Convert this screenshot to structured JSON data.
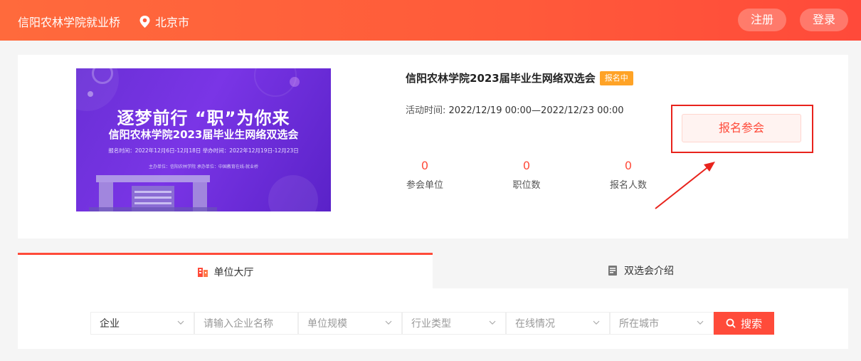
{
  "header": {
    "site_title": "信阳农林学院就业桥",
    "city": "北京市",
    "register_label": "注册",
    "login_label": "登录"
  },
  "event": {
    "title": "信阳农林学院2023届毕业生网络双选会",
    "status_badge": "报名中",
    "time_label": "活动时间:",
    "time_value": "2022/12/19 00:00—2022/12/23 00:00",
    "signup_label": "报名参会",
    "poster": {
      "headline": "逐梦前行 “职”为你来",
      "subline": "信阳农林学院2023届毕业生网络双选会",
      "dates": "报名时间：2022年12月6日-12月18日    举办时间：2022年12月19日-12月23日",
      "organizers": "主办单位：信阳农林学院        承办单位：中国教育在线-就业桥"
    },
    "stats": [
      {
        "value": "0",
        "label": "参会单位"
      },
      {
        "value": "0",
        "label": "职位数"
      },
      {
        "value": "0",
        "label": "报名人数"
      }
    ]
  },
  "tabs": [
    {
      "label": "单位大厅",
      "active": true,
      "icon": "building-icon"
    },
    {
      "label": "双选会介绍",
      "active": false,
      "icon": "book-icon"
    }
  ],
  "filters": {
    "type_select": "企业",
    "name_placeholder": "请输入企业名称",
    "scale_placeholder": "单位规模",
    "industry_placeholder": "行业类型",
    "online_placeholder": "在线情况",
    "city_placeholder": "所在城市",
    "search_label": "搜索"
  },
  "colors": {
    "brand": "#ff4b3a",
    "badge": "#ffa326",
    "highlight_frame": "#e8231c"
  }
}
